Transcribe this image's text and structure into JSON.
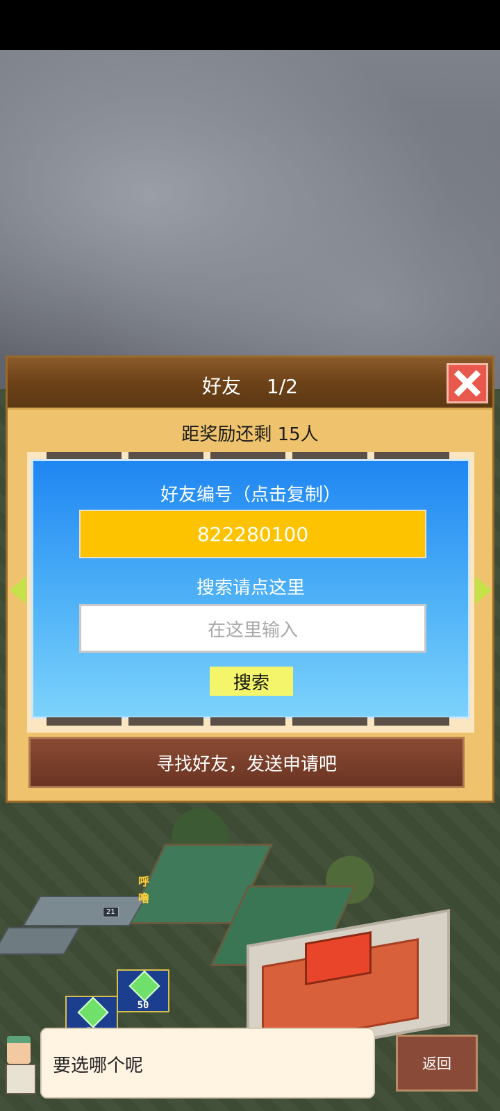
{
  "dialog": {
    "title": "好友　 1/2",
    "reward_text": "距奖励还剩 15人",
    "friend_id_label": "好友编号（点击复制）",
    "friend_id_value": "822280100",
    "search_hint": "搜索请点这里",
    "search_placeholder": "在这里输入",
    "search_button": "搜索",
    "find_friends_button": "寻找好友，发送申请吧"
  },
  "map": {
    "gem_counts": [
      "50",
      "50"
    ],
    "level_tag": "21",
    "shout_text": "呼噜"
  },
  "bottom": {
    "speech_text": "要选哪个呢",
    "back_button": "返回"
  },
  "colors": {
    "panel_blue": "#1f86f2",
    "id_yellow": "#fdc300",
    "close_red": "#e8584c",
    "arrow_green": "#c6e24a"
  },
  "icons": [
    "close-icon",
    "arrow-left-icon",
    "arrow-right-icon",
    "gem-icon"
  ]
}
